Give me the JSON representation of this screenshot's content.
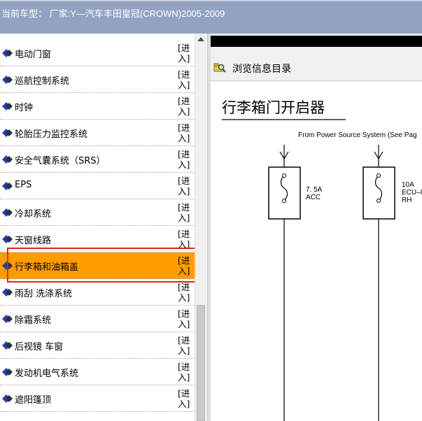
{
  "window": {
    "title": "当前车型： 厂家:Y—汽车丰田皇冠(CROWN)2005-2009"
  },
  "list": {
    "enter_label": "[进入]",
    "items": [
      {
        "label": "电动门窗"
      },
      {
        "label": "巡航控制系统"
      },
      {
        "label": "时钟"
      },
      {
        "label": "轮胎压力监控系统"
      },
      {
        "label": "安全气囊系统（SRS）"
      },
      {
        "label": "EPS"
      },
      {
        "label": "冷却系统"
      },
      {
        "label": "天窗线路"
      },
      {
        "label": "行李箱和油箱盖",
        "selected": true
      },
      {
        "label": "雨刮 洗涤系统"
      },
      {
        "label": "除霜系统"
      },
      {
        "label": "后视镜 车窗"
      },
      {
        "label": "发动机电气系统"
      },
      {
        "label": "遮阳篷顶"
      }
    ]
  },
  "toolbar": {
    "browse_label": "浏览信息目录",
    "browse_icon": "search-folder-icon"
  },
  "diagram": {
    "title": "行李箱门开启器",
    "source_text": "From Power Source System (See Pag",
    "fuse1": {
      "rating": "7. 5A",
      "name": "ACC"
    },
    "fuse2": {
      "rating": "10A",
      "name": "ECU–I",
      "extra": "RH"
    }
  },
  "colors": {
    "title_bar": "#92a3c2",
    "selected_item": "#ff9d00",
    "highlight_box": "#e0231c",
    "item_icon": "#1f3fbf"
  }
}
